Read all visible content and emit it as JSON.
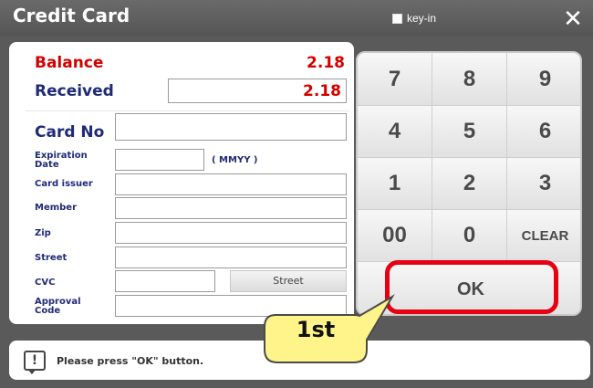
{
  "window": {
    "title": "Credit Card",
    "keyin_label": "key-in",
    "close_icon": "close-icon"
  },
  "form": {
    "balance_label": "Balance",
    "balance_value": "2.18",
    "received_label": "Received",
    "received_value": "2.18",
    "card_no_label": "Card No",
    "expiration_label_line1": "Expiration",
    "expiration_label_line2": "Date",
    "expiration_hint": "( MMYY )",
    "card_issuer_label": "Card issuer",
    "member_label": "Member",
    "zip_label": "Zip",
    "street_label": "Street",
    "cvc_label": "CVC",
    "street_button": "Street",
    "approval_label_line1": "Approval",
    "approval_label_line2": "Code"
  },
  "keypad": {
    "keys": [
      "7",
      "8",
      "9",
      "4",
      "5",
      "6",
      "1",
      "2",
      "3",
      "00",
      "0",
      "CLEAR"
    ],
    "ok": "OK"
  },
  "callout": {
    "text": "1st"
  },
  "status": {
    "message": "Please press \"OK\" button.",
    "icon": "warning-icon"
  },
  "colors": {
    "accent_red": "#e60012",
    "label_blue": "#1f2a78",
    "value_red": "#d40000",
    "callout_fill": "#fff48a"
  }
}
